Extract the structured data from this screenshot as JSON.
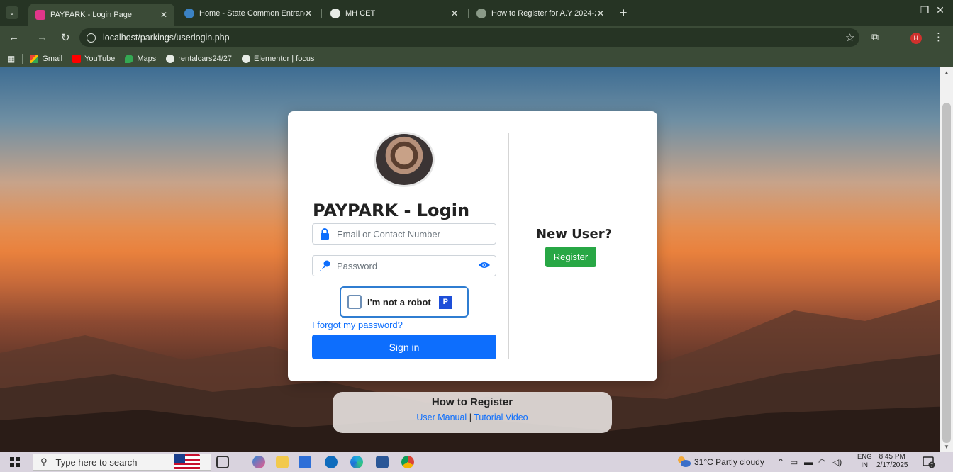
{
  "browser": {
    "tabs": [
      {
        "title": "PAYPARK - Login Page",
        "active": true
      },
      {
        "title": "Home - State Common Entranc",
        "active": false
      },
      {
        "title": "MH CET",
        "active": false
      },
      {
        "title": "How to Register for A.Y 2024-2",
        "active": false
      }
    ],
    "url": "localhost/parkings/userlogin.php",
    "profile_initial": "H",
    "bookmarks": [
      {
        "label": "Gmail",
        "icon": "gmail-icon"
      },
      {
        "label": "YouTube",
        "icon": "youtube-icon"
      },
      {
        "label": "Maps",
        "icon": "maps-icon"
      },
      {
        "label": "rentalcars24/27",
        "icon": "wordpress-icon"
      },
      {
        "label": "Elementor | focus",
        "icon": "wordpress-icon"
      }
    ]
  },
  "login": {
    "title": "PAYPARK - Login",
    "email_placeholder": "Email or Contact Number",
    "password_placeholder": "Password",
    "captcha_label": "I'm not a robot",
    "captcha_logo": "P",
    "forgot_link": "I forgot my password?",
    "signin_label": "Sign in"
  },
  "register_panel": {
    "heading": "New User?",
    "button_label": "Register"
  },
  "howto": {
    "heading": "How to Register",
    "manual_link": "User Manual",
    "separator": "|",
    "video_link": "Tutorial Video"
  },
  "taskbar": {
    "search_placeholder": "Type here to search",
    "weather": "31°C  Partly cloudy",
    "lang_top": "ENG",
    "lang_bottom": "IN",
    "time": "8:45 PM",
    "date": "2/17/2025",
    "notification_count": "7"
  },
  "colors": {
    "primary": "#0d6efd",
    "success": "#28a745",
    "chrome": "#3b4b37"
  }
}
